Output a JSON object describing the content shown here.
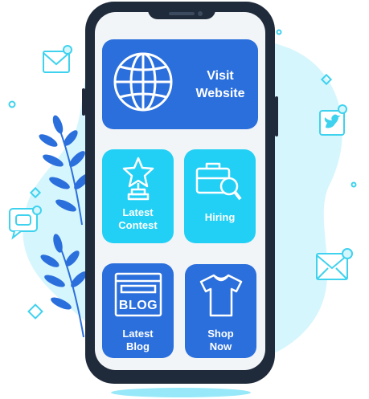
{
  "tiles": {
    "visit": {
      "label": "Visit\nWebsite",
      "icon": "globe-icon"
    },
    "contest": {
      "label": "Latest\nContest",
      "icon": "trophy-icon"
    },
    "hiring": {
      "label": "Hiring",
      "icon": "briefcase-search-icon"
    },
    "blog": {
      "label": "Latest\nBlog",
      "icon": "blog-icon",
      "icon_text": "BLOG"
    },
    "shop": {
      "label": "Shop\nNow",
      "icon": "tshirt-icon"
    }
  },
  "decor": [
    "mail-icon",
    "twitter-icon",
    "chat-icon",
    "leaf-branch-icon"
  ],
  "colors": {
    "phone_frame": "#1f2a3a",
    "tile_blue": "#2b6fdc",
    "tile_cyan": "#23d0f5",
    "blob": "#d6f6fd",
    "accent_outline": "#3fd2ee",
    "leaf": "#2b6fdc"
  }
}
